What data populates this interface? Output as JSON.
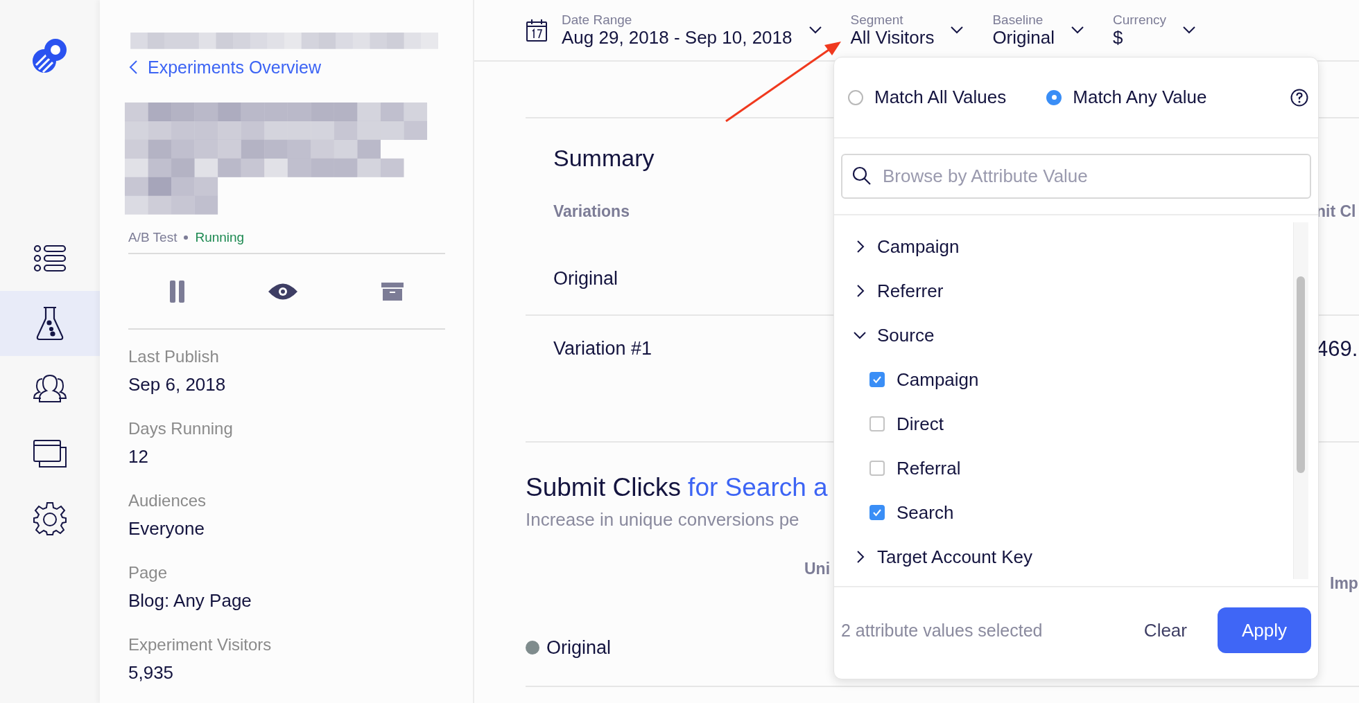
{
  "nav_rail": {
    "items": [
      {
        "kind": "list",
        "selected": false
      },
      {
        "kind": "experiments",
        "selected": true
      },
      {
        "kind": "audiences",
        "selected": false
      },
      {
        "kind": "pages",
        "selected": false
      },
      {
        "kind": "settings",
        "selected": false
      }
    ]
  },
  "experiment_panel": {
    "back_link": "Experiments Overview",
    "type": "A/B Test",
    "status": "Running",
    "details": [
      {
        "label": "Last Publish",
        "value": "Sep 6, 2018"
      },
      {
        "label": "Days Running",
        "value": "12"
      },
      {
        "label": "Audiences",
        "value": "Everyone"
      },
      {
        "label": "Page",
        "value": "Blog: Any Page"
      },
      {
        "label": "Experiment Visitors",
        "value": "5,935"
      }
    ]
  },
  "filters": [
    {
      "kind": "date",
      "label": "Date Range",
      "value": "Aug 29, 2018 - Sep 10, 2018"
    },
    {
      "kind": "plain",
      "label": "Segment",
      "value": "All Visitors"
    },
    {
      "kind": "plain",
      "label": "Baseline",
      "value": "Original"
    },
    {
      "kind": "plain",
      "label": "Currency",
      "value": "$"
    }
  ],
  "summary": {
    "title": "Summary",
    "column_1": "Variations",
    "column_2": "nit Cl",
    "rows": [
      {
        "name": "Original"
      },
      {
        "name": "Variation #1",
        "column_2": "469."
      }
    ]
  },
  "metric": {
    "title": "Submit Clicks",
    "title_link": "for Search a",
    "subtitle": "Increase in unique conversions pe",
    "column_1": "Uni",
    "column_2": "Imp",
    "rows": [
      {
        "name": "Original"
      }
    ]
  },
  "segment_dropdown": {
    "match_options": [
      {
        "label": "Match All Values",
        "selected": false
      },
      {
        "label": "Match Any Value",
        "selected": true
      }
    ],
    "search": {
      "placeholder": "Browse by Attribute Value"
    },
    "attributes": [
      {
        "label": "Campaign",
        "expanded": false
      },
      {
        "label": "Referrer",
        "expanded": false
      },
      {
        "label": "Source",
        "expanded": true,
        "children": [
          {
            "label": "Campaign",
            "checked": true
          },
          {
            "label": "Direct",
            "checked": false
          },
          {
            "label": "Referral",
            "checked": false
          },
          {
            "label": "Search",
            "checked": true
          }
        ]
      },
      {
        "label": "Target Account Key",
        "expanded": false
      }
    ],
    "selection_summary": "2 attribute values selected",
    "buttons": [
      {
        "kind": "secondary",
        "label": "Clear"
      },
      {
        "kind": "primary",
        "label": "Apply"
      }
    ]
  }
}
